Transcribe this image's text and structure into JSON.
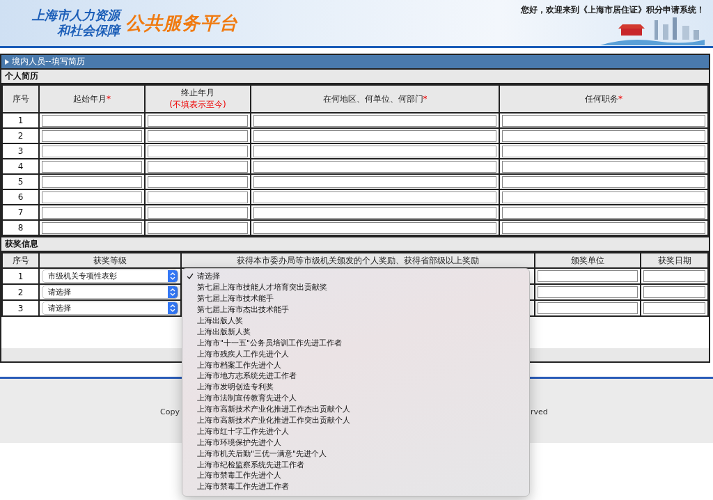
{
  "header": {
    "logo_line1": "上海市人力资源",
    "logo_line2": "和社会保障",
    "logo_title": "公共服务平台",
    "welcome": "您好，欢迎来到《上海市居住证》积分申请系统！"
  },
  "panel": {
    "title": "境内人员--填写简历"
  },
  "resume": {
    "section": "个人简历",
    "columns": [
      {
        "label": "序号"
      },
      {
        "label": "起始年月",
        "mark": "*"
      },
      {
        "label": "终止年月",
        "note": "(不填表示至今)"
      },
      {
        "label": "在何地区、何单位、何部门",
        "mark": "*"
      },
      {
        "label": "任何职务",
        "mark": "*"
      }
    ],
    "rows": [
      "1",
      "2",
      "3",
      "4",
      "5",
      "6",
      "7",
      "8"
    ]
  },
  "awards": {
    "section": "获奖信息",
    "columns": [
      {
        "label": "序号"
      },
      {
        "label": "获奖等级"
      },
      {
        "label": "获得本市委办局等市级机关颁发的个人奖励、获得省部级以上奖励"
      },
      {
        "label": "颁奖单位"
      },
      {
        "label": "获奖日期"
      }
    ],
    "rows": [
      {
        "index": "1",
        "level": "市级机关专项性表彰"
      },
      {
        "index": "2",
        "level": "请选择"
      },
      {
        "index": "3",
        "level": "请选择"
      }
    ]
  },
  "dropdown": {
    "options": [
      {
        "label": "请选择",
        "selected": true
      },
      {
        "label": "第七届上海市技能人才培育突出贡献奖",
        "selected": false
      },
      {
        "label": "第七届上海市技术能手",
        "selected": false
      },
      {
        "label": "第七届上海市杰出技术能手",
        "selected": false
      },
      {
        "label": "上海出版人奖",
        "selected": false
      },
      {
        "label": "上海出版新人奖",
        "selected": false
      },
      {
        "label": "上海市\"十一五\"公务员培训工作先进工作者",
        "selected": false
      },
      {
        "label": "上海市残疾人工作先进个人",
        "selected": false
      },
      {
        "label": "上海市档案工作先进个人",
        "selected": false
      },
      {
        "label": "上海市地方志系统先进工作者",
        "selected": false
      },
      {
        "label": "上海市发明创造专利奖",
        "selected": false
      },
      {
        "label": "上海市法制宣传教育先进个人",
        "selected": false
      },
      {
        "label": "上海市高新技术产业化推进工作杰出贡献个人",
        "selected": false
      },
      {
        "label": "上海市高新技术产业化推进工作突出贡献个人",
        "selected": false
      },
      {
        "label": "上海市红十字工作先进个人",
        "selected": false
      },
      {
        "label": "上海市环境保护先进个人",
        "selected": false
      },
      {
        "label": "上海市机关后勤\"三优一满意\"先进个人",
        "selected": false
      },
      {
        "label": "上海市纪检监察系统先进工作者",
        "selected": false
      },
      {
        "label": "上海市禁毒工作先进个人",
        "selected": false
      },
      {
        "label": "上海市禁毒工作先进工作者",
        "selected": false
      }
    ]
  },
  "footer": {
    "left": "Copy",
    "right": "rved"
  }
}
